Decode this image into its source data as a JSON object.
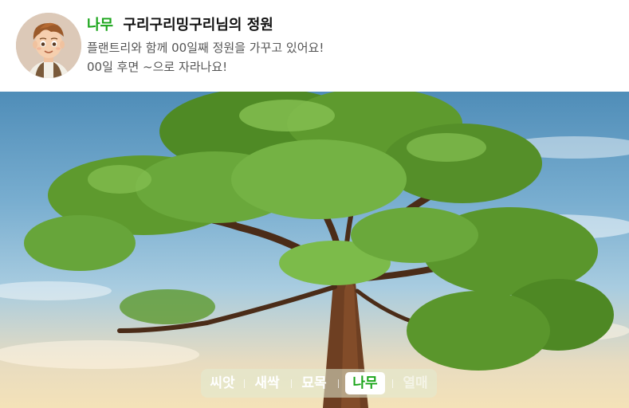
{
  "header": {
    "stage_label": "나무",
    "garden_title": "구리구리밍구리님의 정원",
    "line1": "플랜트리와 함께 00일째 정원을 가꾸고 있어요!",
    "line2": "00일 후면 ~으로 자라나요!"
  },
  "stages": [
    {
      "label": "씨앗",
      "active": false,
      "dim": false
    },
    {
      "label": "새싹",
      "active": false,
      "dim": false
    },
    {
      "label": "묘목",
      "active": false,
      "dim": false
    },
    {
      "label": "나무",
      "active": true,
      "dim": false
    },
    {
      "label": "열매",
      "active": false,
      "dim": true
    }
  ],
  "colors": {
    "accent_green": "#1aa51a",
    "leaf_green": "#5e9a2e",
    "sky_blue": "#79aed0"
  },
  "icons": {
    "avatar": "cartoon-boy-avatar"
  }
}
